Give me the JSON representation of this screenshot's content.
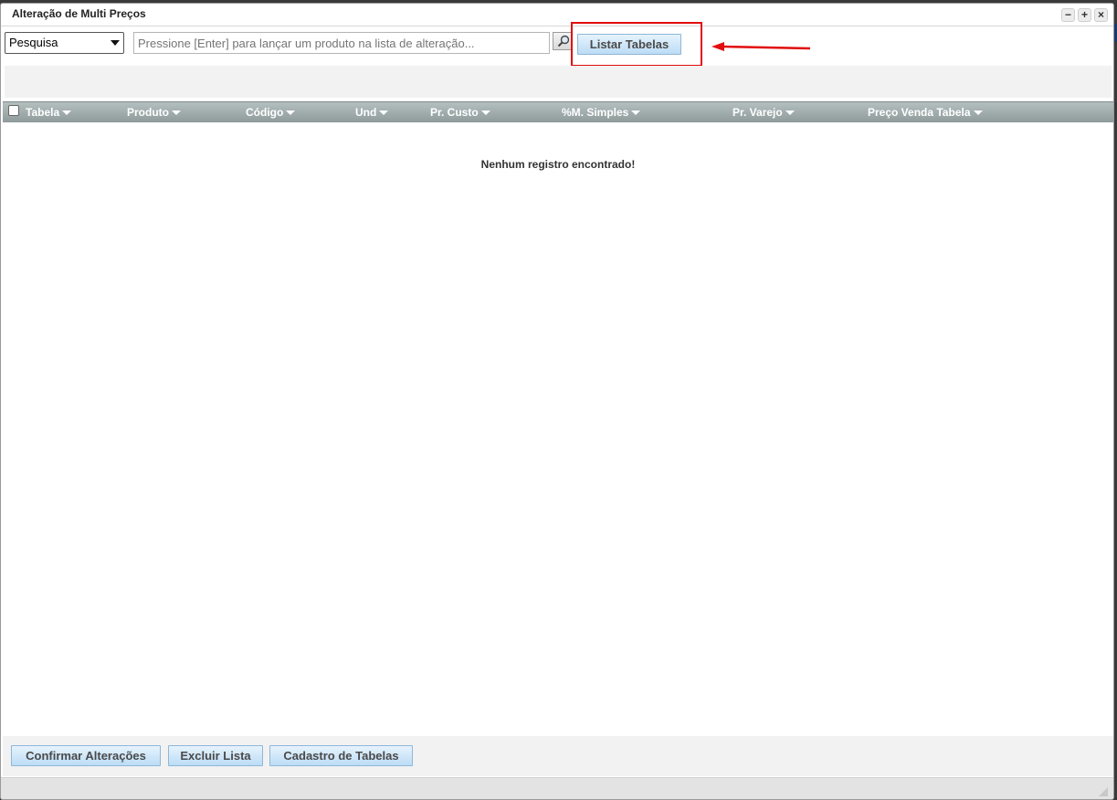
{
  "window": {
    "title": "Alteração de Multi Preços",
    "controls": [
      "minimize",
      "maximize",
      "close"
    ]
  },
  "toolbar": {
    "mode_select_value": "Pesquisa",
    "search_placeholder": "Pressione [Enter] para lançar um produto na lista de alteração...",
    "search_button_icon": "magnifier-icon",
    "list_tables_label": "Listar Tabelas"
  },
  "annotation": {
    "highlight_color": "#e10d0d",
    "arrow_color": "#e10d0d"
  },
  "grid": {
    "columns": [
      "Tabela",
      "Produto",
      "Código",
      "Und",
      "Pr. Custo",
      "%M. Simples",
      "Pr. Varejo",
      "Preço Venda Tabela"
    ],
    "empty_message": "Nenhum registro encontrado!"
  },
  "footer": {
    "confirm_label": "Confirmar Alterações",
    "delete_list_label": "Excluir Lista",
    "tables_register_label": "Cadastro de Tabelas"
  },
  "colors": {
    "button_gradient_top": "#e6f3fd",
    "button_gradient_bottom": "#bcdcf5",
    "grid_header": "#a3adad"
  }
}
